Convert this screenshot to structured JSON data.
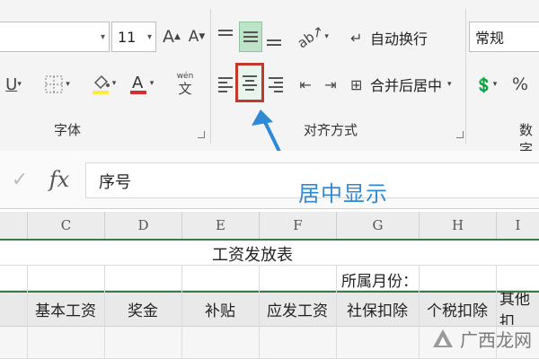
{
  "ribbon": {
    "font_size": "11",
    "font_size_up": "A",
    "font_size_down": "A",
    "wrap_text_label": "自动换行",
    "merge_center_label": "合并后居中",
    "number_format": "常规",
    "percent_symbol": "%",
    "phonetic_top": "wén",
    "phonetic_bottom": "文",
    "groups": {
      "font": "字体",
      "alignment": "对齐方式",
      "number": "数字"
    }
  },
  "colors": {
    "highlight_red": "#c0392b",
    "active_green": "#3a7a4a",
    "annotation_blue": "#2e8ad6"
  },
  "annotation": {
    "text": "居中显示"
  },
  "formula_bar": {
    "cancel_symbol": "✓",
    "fx_label": "fx",
    "content": "序号"
  },
  "sheet": {
    "columns": [
      "C",
      "D",
      "E",
      "F",
      "G",
      "H",
      "I"
    ],
    "title": "工资发放表",
    "month_label": "所属月份：",
    "headers": [
      "基本工资",
      "奖金",
      "补贴",
      "应发工资",
      "社保扣除",
      "个税扣除",
      "其他扣"
    ]
  },
  "watermark": {
    "text": "广西龙网"
  }
}
